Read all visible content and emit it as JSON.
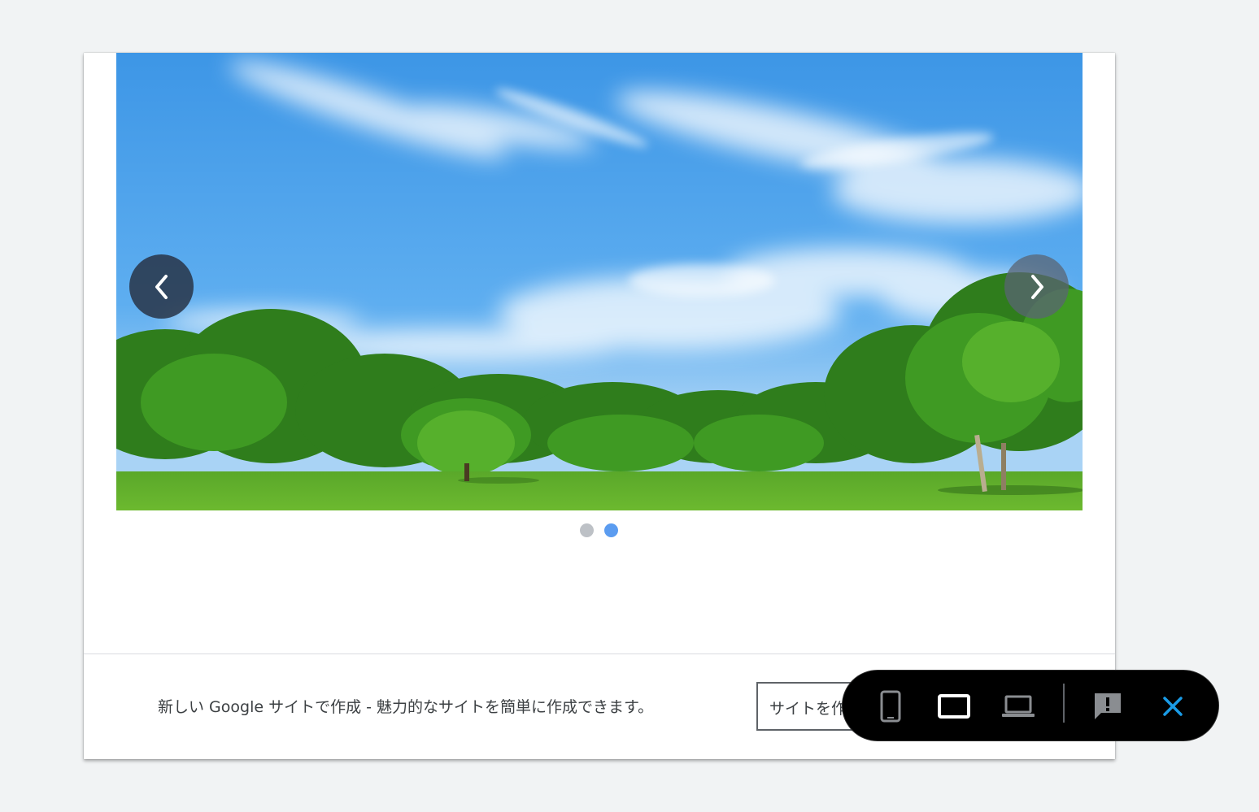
{
  "carousel": {
    "slide_count": 2,
    "active_slide": 2
  },
  "footer": {
    "promo_text": "新しい Google サイトで作成 - 魅力的なサイトを簡単に作成できます。",
    "create_button_label": "サイトを作成"
  },
  "toolbar": {
    "icons": [
      "phone-icon",
      "tablet-icon",
      "laptop-icon",
      "feedback-icon",
      "close-icon"
    ],
    "selected": "tablet-icon"
  },
  "colors": {
    "page_background": "#f1f3f4",
    "active_dot": "#5b9cf0",
    "inactive_dot": "#bdc1c6",
    "close_accent": "#1a9be6",
    "toolbar_background": "#000000"
  }
}
